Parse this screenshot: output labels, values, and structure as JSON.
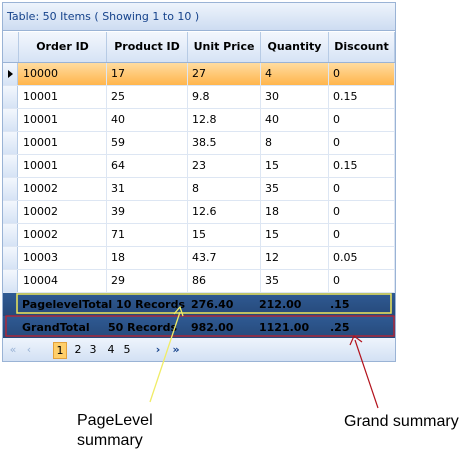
{
  "caption": "Table: 50 Items ( Showing 1 to 10 )",
  "columns": [
    "Order ID",
    "Product ID",
    "Unit Price",
    "Quantity",
    "Discount"
  ],
  "rows": [
    {
      "order_id": "10000",
      "product_id": "17",
      "unit_price": "27",
      "quantity": "4",
      "discount": "0",
      "selected": true
    },
    {
      "order_id": "10001",
      "product_id": "25",
      "unit_price": "9.8",
      "quantity": "30",
      "discount": "0.15"
    },
    {
      "order_id": "10001",
      "product_id": "40",
      "unit_price": "12.8",
      "quantity": "40",
      "discount": "0"
    },
    {
      "order_id": "10001",
      "product_id": "59",
      "unit_price": "38.5",
      "quantity": "8",
      "discount": "0"
    },
    {
      "order_id": "10001",
      "product_id": "64",
      "unit_price": "23",
      "quantity": "15",
      "discount": "0.15"
    },
    {
      "order_id": "10002",
      "product_id": "31",
      "unit_price": "8",
      "quantity": "35",
      "discount": "0"
    },
    {
      "order_id": "10002",
      "product_id": "39",
      "unit_price": "12.6",
      "quantity": "18",
      "discount": "0"
    },
    {
      "order_id": "10002",
      "product_id": "71",
      "unit_price": "15",
      "quantity": "15",
      "discount": "0"
    },
    {
      "order_id": "10003",
      "product_id": "18",
      "unit_price": "43.7",
      "quantity": "12",
      "discount": "0.05"
    },
    {
      "order_id": "10004",
      "product_id": "29",
      "unit_price": "86",
      "quantity": "35",
      "discount": "0"
    }
  ],
  "page_summary": {
    "label": "PagelevelTotal 10 Records",
    "unit_price": "276.40",
    "quantity": "212.00",
    "discount": ".15"
  },
  "grand_summary": {
    "label": "GrandTotal",
    "records": "50 Records",
    "unit_price": "982.00",
    "quantity": "1121.00",
    "discount": ".25"
  },
  "pager": {
    "first": "«",
    "prev": "‹",
    "pages": [
      "1",
      "2",
      "3",
      "4",
      "5"
    ],
    "current": "1",
    "next": "›",
    "last": "»"
  },
  "annotations": {
    "page_level": "PageLevel\nsummary",
    "grand": "Grand summary"
  },
  "colors": {
    "page_summary_outline": "#f0e85a",
    "grand_summary_outline": "#c81e2a",
    "page_arrow": "#f0ec66",
    "grand_arrow": "#b3121c",
    "selected_row": "#ffb54c",
    "summary_row": "#2f5a93"
  },
  "icons": {
    "row_indicator": "triangle-right-icon"
  }
}
